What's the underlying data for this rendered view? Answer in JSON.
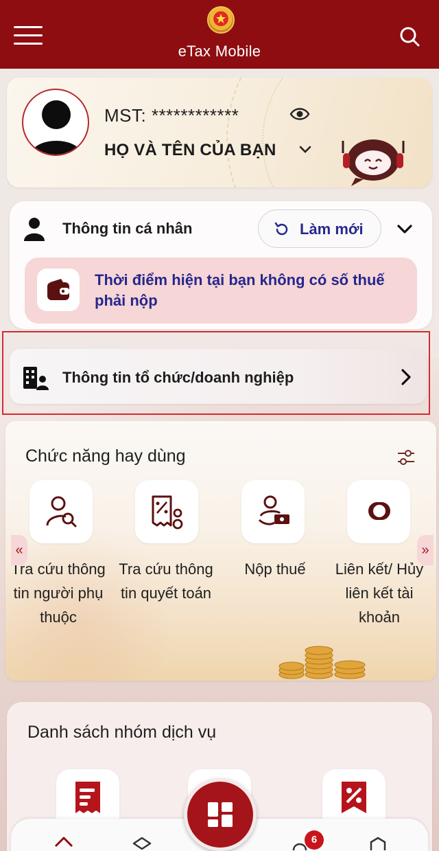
{
  "header": {
    "title": "eTax Mobile",
    "menu_icon": "hamburger-icon",
    "search_icon": "search-icon",
    "emblem": "national-emblem-icon"
  },
  "profile": {
    "mst_label": "MST: ************",
    "name": "HỌ VÀ TÊN CỦA BẠN",
    "visibility_icon": "eye-icon",
    "assistant_icon": "chatbot-robot-icon"
  },
  "personal": {
    "title": "Thông tin cá nhân",
    "refresh_label": "Làm mới",
    "tax_message": "Thời điểm hiện tại bạn không có số thuế phải nộp"
  },
  "organization": {
    "title": "Thông tin tổ chức/doanh nghiệp"
  },
  "frequent": {
    "title": "Chức năng hay dùng",
    "items": [
      {
        "label": "Tra cứu thông tin người phụ thuộc",
        "icon": "person-search-icon"
      },
      {
        "label": "Tra cứu thông tin quyết toán",
        "icon": "settlement-receipt-icon"
      },
      {
        "label": "Nộp thuế",
        "icon": "pay-tax-icon"
      },
      {
        "label": "Liên kết/ Hủy liên kết tài khoản",
        "icon": "link-icon"
      }
    ],
    "scroll_left": "«",
    "scroll_right": "»"
  },
  "service_groups": {
    "title": "Danh sách nhóm dịch vụ",
    "tiles": [
      "document-list-icon",
      "receipt-icon",
      "tax-percent-icon"
    ]
  },
  "bottom_nav": {
    "notification_count": "6",
    "icons": [
      "home-icon",
      "layers-icon",
      "grid-menu-icon",
      "bell-icon",
      "shield-icon"
    ]
  },
  "colors": {
    "brand_red": "#8e0d11",
    "accent_navy": "#262a8c",
    "note_bg": "#f6d6d6",
    "highlight_border": "#d12b32"
  }
}
